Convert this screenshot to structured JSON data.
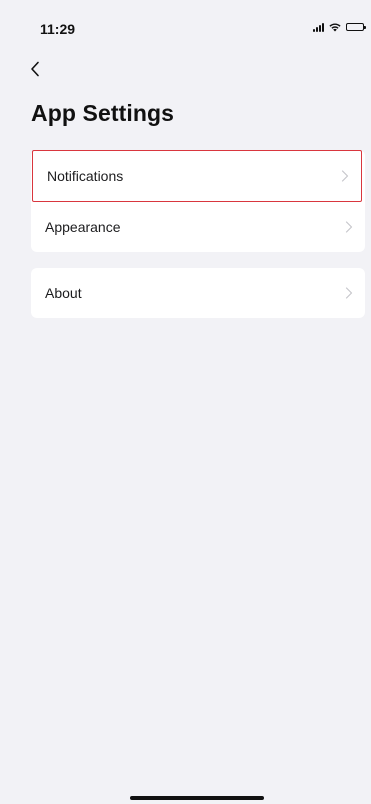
{
  "status_bar": {
    "time": "11:29"
  },
  "nav": {
    "back_icon": "chevron-left-icon"
  },
  "page": {
    "title": "App Settings"
  },
  "settings": {
    "group1": [
      {
        "label": "Notifications",
        "icon": "chevron-right-icon",
        "highlighted": true
      },
      {
        "label": "Appearance",
        "icon": "chevron-right-icon"
      }
    ],
    "group2": [
      {
        "label": "About",
        "icon": "chevron-right-icon"
      }
    ]
  },
  "colors": {
    "background": "#f2f2f6",
    "card": "#ffffff",
    "highlight_border": "#d9363e",
    "chevron": "#c7c7cc"
  }
}
